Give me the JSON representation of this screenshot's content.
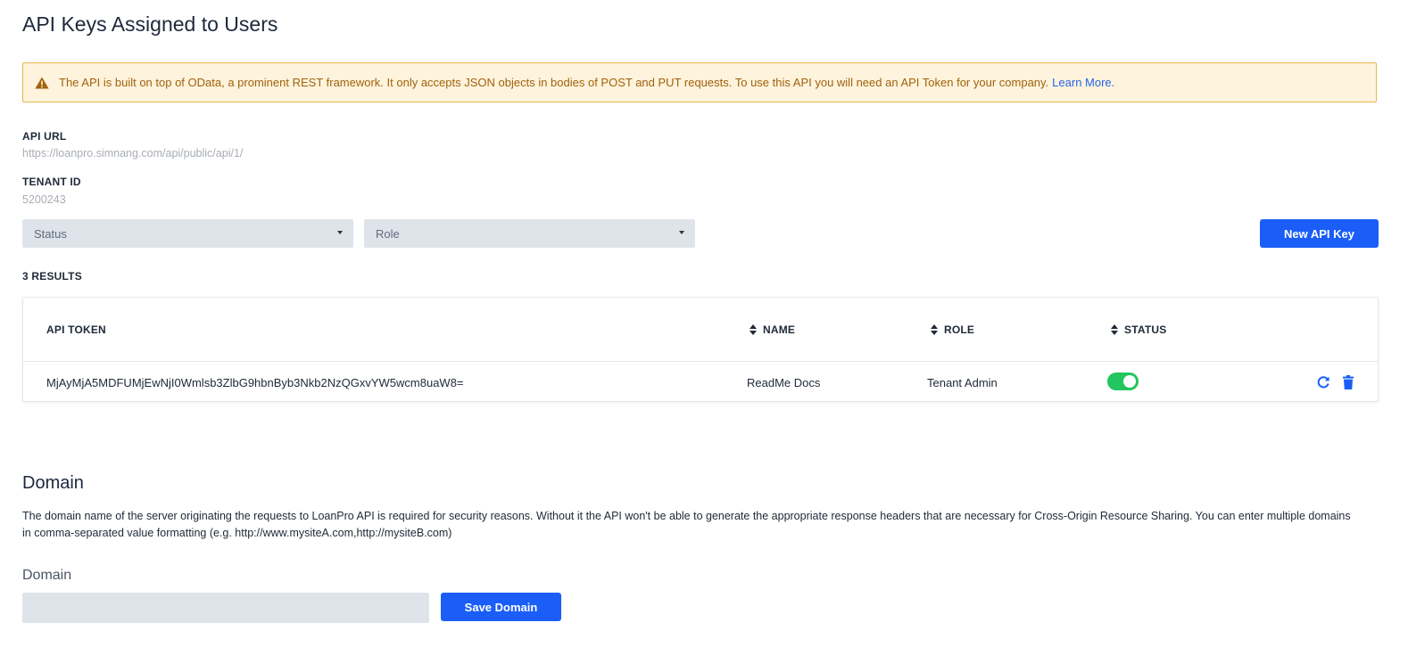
{
  "page": {
    "title": "API Keys Assigned to Users"
  },
  "alert": {
    "message": "The API is built on top of OData, a prominent REST framework. It only accepts JSON objects in bodies of POST and PUT requests. To use this API you will need an API Token for your company.",
    "link_label": "Learn More.",
    "icon": "warning-icon"
  },
  "api_url": {
    "label": "API URL",
    "value": "https://loanpro.simnang.com/api/public/api/1/"
  },
  "tenant": {
    "label": "TENANT ID",
    "value": "5200243"
  },
  "filters": {
    "status_placeholder": "Status",
    "role_placeholder": "Role"
  },
  "new_key_button": "New API Key",
  "results": {
    "count_label": "3 RESULTS"
  },
  "table": {
    "headers": {
      "token": "API TOKEN",
      "name": "NAME",
      "role": "ROLE",
      "status": "STATUS"
    },
    "rows": [
      {
        "token": "MjAyMjA5MDFUMjEwNjI0Wmlsb3ZlbG9hbnByb3Nkb2NzQGxvYW5wcm8uaW8=",
        "name": "ReadMe Docs",
        "role": "Tenant Admin",
        "status_active": true
      }
    ]
  },
  "domain_section": {
    "title": "Domain",
    "description": "The domain name of the server originating the requests to LoanPro API is required for security reasons. Without it the API won't be able to generate the appropriate response headers that are necessary for Cross-Origin Resource Sharing. You can enter multiple domains in comma-separated value formatting (e.g. http://www.mysiteA.com,http://mysiteB.com)",
    "field_label": "Domain",
    "field_value": "",
    "save_button": "Save Domain"
  },
  "colors": {
    "primary": "#1a5ef7",
    "alert_bg": "#fef3dc",
    "alert_border": "#e8b84a",
    "alert_text": "#a0620c",
    "toggle_on": "#22c55e",
    "input_bg": "#dfe3ea"
  }
}
